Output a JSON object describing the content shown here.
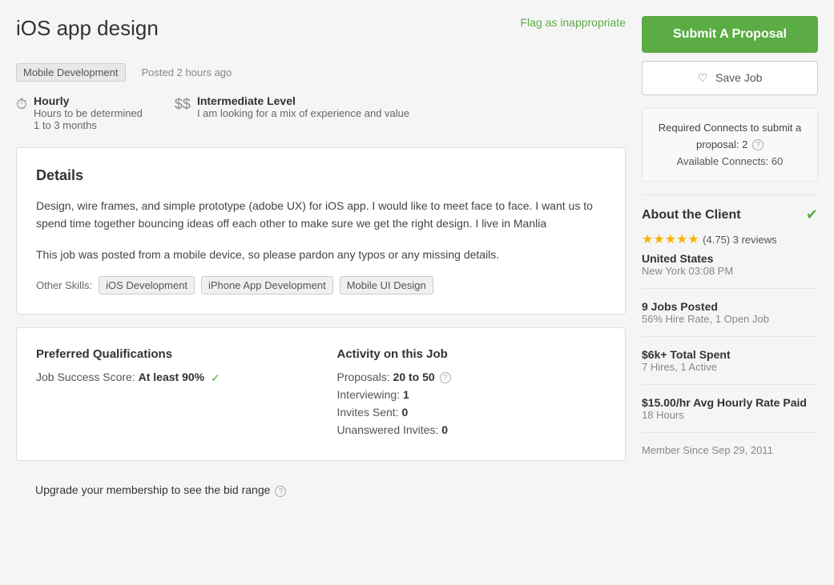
{
  "header": {
    "title": "iOS app design",
    "flag_label": "Flag as inappropriate"
  },
  "job_meta": {
    "category": "Mobile Development",
    "posted": "Posted 2 hours ago"
  },
  "job_info": {
    "type_label": "Hourly",
    "type_sub1": "Hours to be determined",
    "type_sub2": "1 to 3 months",
    "level_symbol": "$$",
    "level_label": "Intermediate Level",
    "level_sub": "I am looking for a mix of experience and value"
  },
  "details": {
    "title": "Details",
    "description1": "Design, wire frames, and simple prototype (adobe UX) for iOS app. I would like to meet face to face.  I want us to spend time together bouncing ideas off each other to make sure we get the right design.  I live in Manlia",
    "description2": "This job was posted from a mobile device, so please pardon any typos or any missing details.",
    "other_skills_label": "Other Skills:",
    "skills": [
      "iOS Development",
      "iPhone App Development",
      "Mobile UI Design"
    ]
  },
  "qualifications": {
    "title": "Preferred Qualifications",
    "job_success_label": "Job Success Score:",
    "job_success_value": "At least 90%"
  },
  "activity": {
    "title": "Activity on this Job",
    "proposals_label": "Proposals:",
    "proposals_value": "20 to 50",
    "interviewing_label": "Interviewing:",
    "interviewing_value": "1",
    "invites_sent_label": "Invites Sent:",
    "invites_sent_value": "0",
    "unanswered_label": "Unanswered Invites:",
    "unanswered_value": "0"
  },
  "upgrade": {
    "text": "Upgrade your membership to see the bid range"
  },
  "sidebar": {
    "submit_label": "Submit A Proposal",
    "save_label": "Save Job",
    "connects_main": "Required Connects to submit a proposal: 2",
    "connects_avail": "Available Connects: 60",
    "about_title": "About the Client",
    "rating": "4.75",
    "reviews": "3 reviews",
    "country": "United States",
    "city_time": "New York 03:08 PM",
    "jobs_posted_label": "$9 Jobs Posted",
    "jobs_posted_sub": "56% Hire Rate, 1 Open Job",
    "total_spent_label": "$6k+ Total Spent",
    "total_spent_sub": "7 Hires, 1 Active",
    "avg_rate_label": "$15.00/hr Avg Hourly Rate Paid",
    "avg_rate_sub": "18 Hours",
    "member_since": "Member Since Sep 29, 2011"
  }
}
